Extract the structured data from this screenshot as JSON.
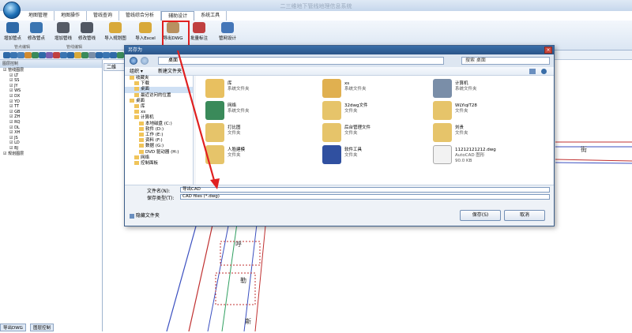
{
  "app": {
    "title": "二三维地下管线地理信息系统"
  },
  "menu_tabs": [
    "地图管理",
    "地图操作",
    "管线查询",
    "管线综合分析",
    "辅助设计",
    "系统工具"
  ],
  "active_tab_index": 4,
  "ribbon": {
    "buttons": [
      {
        "label": "增加管点",
        "icon": "add-point-icon",
        "color": "#2f6aa8"
      },
      {
        "label": "修改管点",
        "icon": "edit-point-icon",
        "color": "#3a75b2"
      },
      {
        "label": "增加管线",
        "icon": "add-pipe-icon",
        "color": "#555b66"
      },
      {
        "label": "修改管线",
        "icon": "edit-pipe-icon",
        "color": "#505763"
      },
      {
        "label": "导入规划图",
        "icon": "import-plan-icon",
        "color": "#d8a93a"
      },
      {
        "label": "导入Excel",
        "icon": "import-excel-icon",
        "color": "#d8a93a"
      },
      {
        "label": "导出DWG",
        "icon": "export-dwg-icon",
        "color": "#b89060"
      },
      {
        "label": "批量标注",
        "icon": "batch-label-icon",
        "color": "#c04040"
      },
      {
        "label": "管网设计",
        "icon": "network-design-icon",
        "color": "#4476b8"
      }
    ],
    "groups": [
      "管点编辑",
      "管线编辑"
    ]
  },
  "left_panel": {
    "header": "图层控制",
    "tree": [
      {
        "label": "管线图层",
        "expanded": true,
        "child": false
      },
      {
        "label": "LT",
        "child": true
      },
      {
        "label": "SS",
        "child": true
      },
      {
        "label": "JY",
        "child": true
      },
      {
        "label": "WS",
        "child": true
      },
      {
        "label": "DX",
        "child": true
      },
      {
        "label": "YD",
        "child": true
      },
      {
        "label": "TT",
        "child": true
      },
      {
        "label": "GB",
        "child": true
      },
      {
        "label": "ZH",
        "child": true
      },
      {
        "label": "RQ",
        "child": true
      },
      {
        "label": "DL",
        "child": true
      },
      {
        "label": "XH",
        "child": true
      },
      {
        "label": "JS",
        "child": true
      },
      {
        "label": "LD",
        "child": true
      },
      {
        "label": "BJ",
        "child": true
      },
      {
        "label": "规划图层",
        "child": false
      }
    ],
    "bottom_tabs": [
      "导出DWG",
      "图层控制"
    ]
  },
  "map": {
    "tab": "二维",
    "labels": [
      "河",
      "街",
      "呼",
      "勒",
      "斯"
    ]
  },
  "dialog": {
    "title": "另存为",
    "address": "桌面",
    "search_placeholder": "搜索 桌面",
    "organize": "组织 ▾",
    "new_folder": "新建文件夹",
    "nav": [
      {
        "label": "收藏夹",
        "level": 0
      },
      {
        "label": "下载",
        "level": 1
      },
      {
        "label": "桌面",
        "level": 1,
        "selected": true
      },
      {
        "label": "最近访问的位置",
        "level": 1
      },
      {
        "label": "桌面",
        "level": 0
      },
      {
        "label": "库",
        "level": 1
      },
      {
        "label": "xs",
        "level": 1
      },
      {
        "label": "计算机",
        "level": 1
      },
      {
        "label": "本地磁盘 (C:)",
        "level": 2
      },
      {
        "label": "软件 (D:)",
        "level": 2
      },
      {
        "label": "工作 (E:)",
        "level": 2
      },
      {
        "label": "资料 (F:)",
        "level": 2
      },
      {
        "label": "数据 (G:)",
        "level": 2
      },
      {
        "label": "DVD 驱动器 (H:)",
        "level": 2
      },
      {
        "label": "网络",
        "level": 1
      },
      {
        "label": "控制面板",
        "level": 1
      }
    ],
    "files": [
      {
        "name": "库",
        "sub": "系统文件夹",
        "extra": "",
        "icon": "library-icon",
        "color": "#e8c060"
      },
      {
        "name": "xs",
        "sub": "系统文件夹",
        "extra": "",
        "icon": "user-folder-icon",
        "color": "#e0b050"
      },
      {
        "name": "计算机",
        "sub": "系统文件夹",
        "extra": "",
        "icon": "computer-icon",
        "color": "#7a8ea8"
      },
      {
        "name": "网络",
        "sub": "系统文件夹",
        "extra": "",
        "icon": "network-icon",
        "color": "#3a8a5a"
      },
      {
        "name": "32dwg文件",
        "sub": "文件夹",
        "extra": "",
        "icon": "folder-icon",
        "color": "#e6c46a"
      },
      {
        "name": "WLYiqiT28",
        "sub": "文件夹",
        "extra": "",
        "icon": "folder-icon",
        "color": "#e6c46a"
      },
      {
        "name": "打比图",
        "sub": "文件夹",
        "extra": "",
        "icon": "folder-icon",
        "color": "#e6c46a"
      },
      {
        "name": "后台管理文件",
        "sub": "文件夹",
        "extra": "",
        "icon": "folder-icon",
        "color": "#e6c46a"
      },
      {
        "name": "刘贵",
        "sub": "文件夹",
        "extra": "",
        "icon": "folder-icon",
        "color": "#e6c46a"
      },
      {
        "name": "人脸建模",
        "sub": "文件夹",
        "extra": "",
        "icon": "folder-icon",
        "color": "#e6c46a"
      },
      {
        "name": "软件工具",
        "sub": "文件夹",
        "extra": "",
        "icon": "software-folder-icon",
        "color": "#3050a0"
      },
      {
        "name": "11212121212.dwg",
        "sub": "AutoCAD 图形",
        "extra": "90.0 KB",
        "icon": "dwg-file-icon",
        "color": "#f2f2f2"
      }
    ],
    "filename_label": "文件名(N):",
    "filename_value": "导出CAD",
    "filetype_label": "保存类型(T):",
    "filetype_value": "CAD files (*.dwg)",
    "hide_folders": "隐藏文件夹",
    "save": "保存(S)",
    "cancel": "取消"
  },
  "colors": {
    "accent": "#2b5589",
    "highlight": "#e02020"
  }
}
